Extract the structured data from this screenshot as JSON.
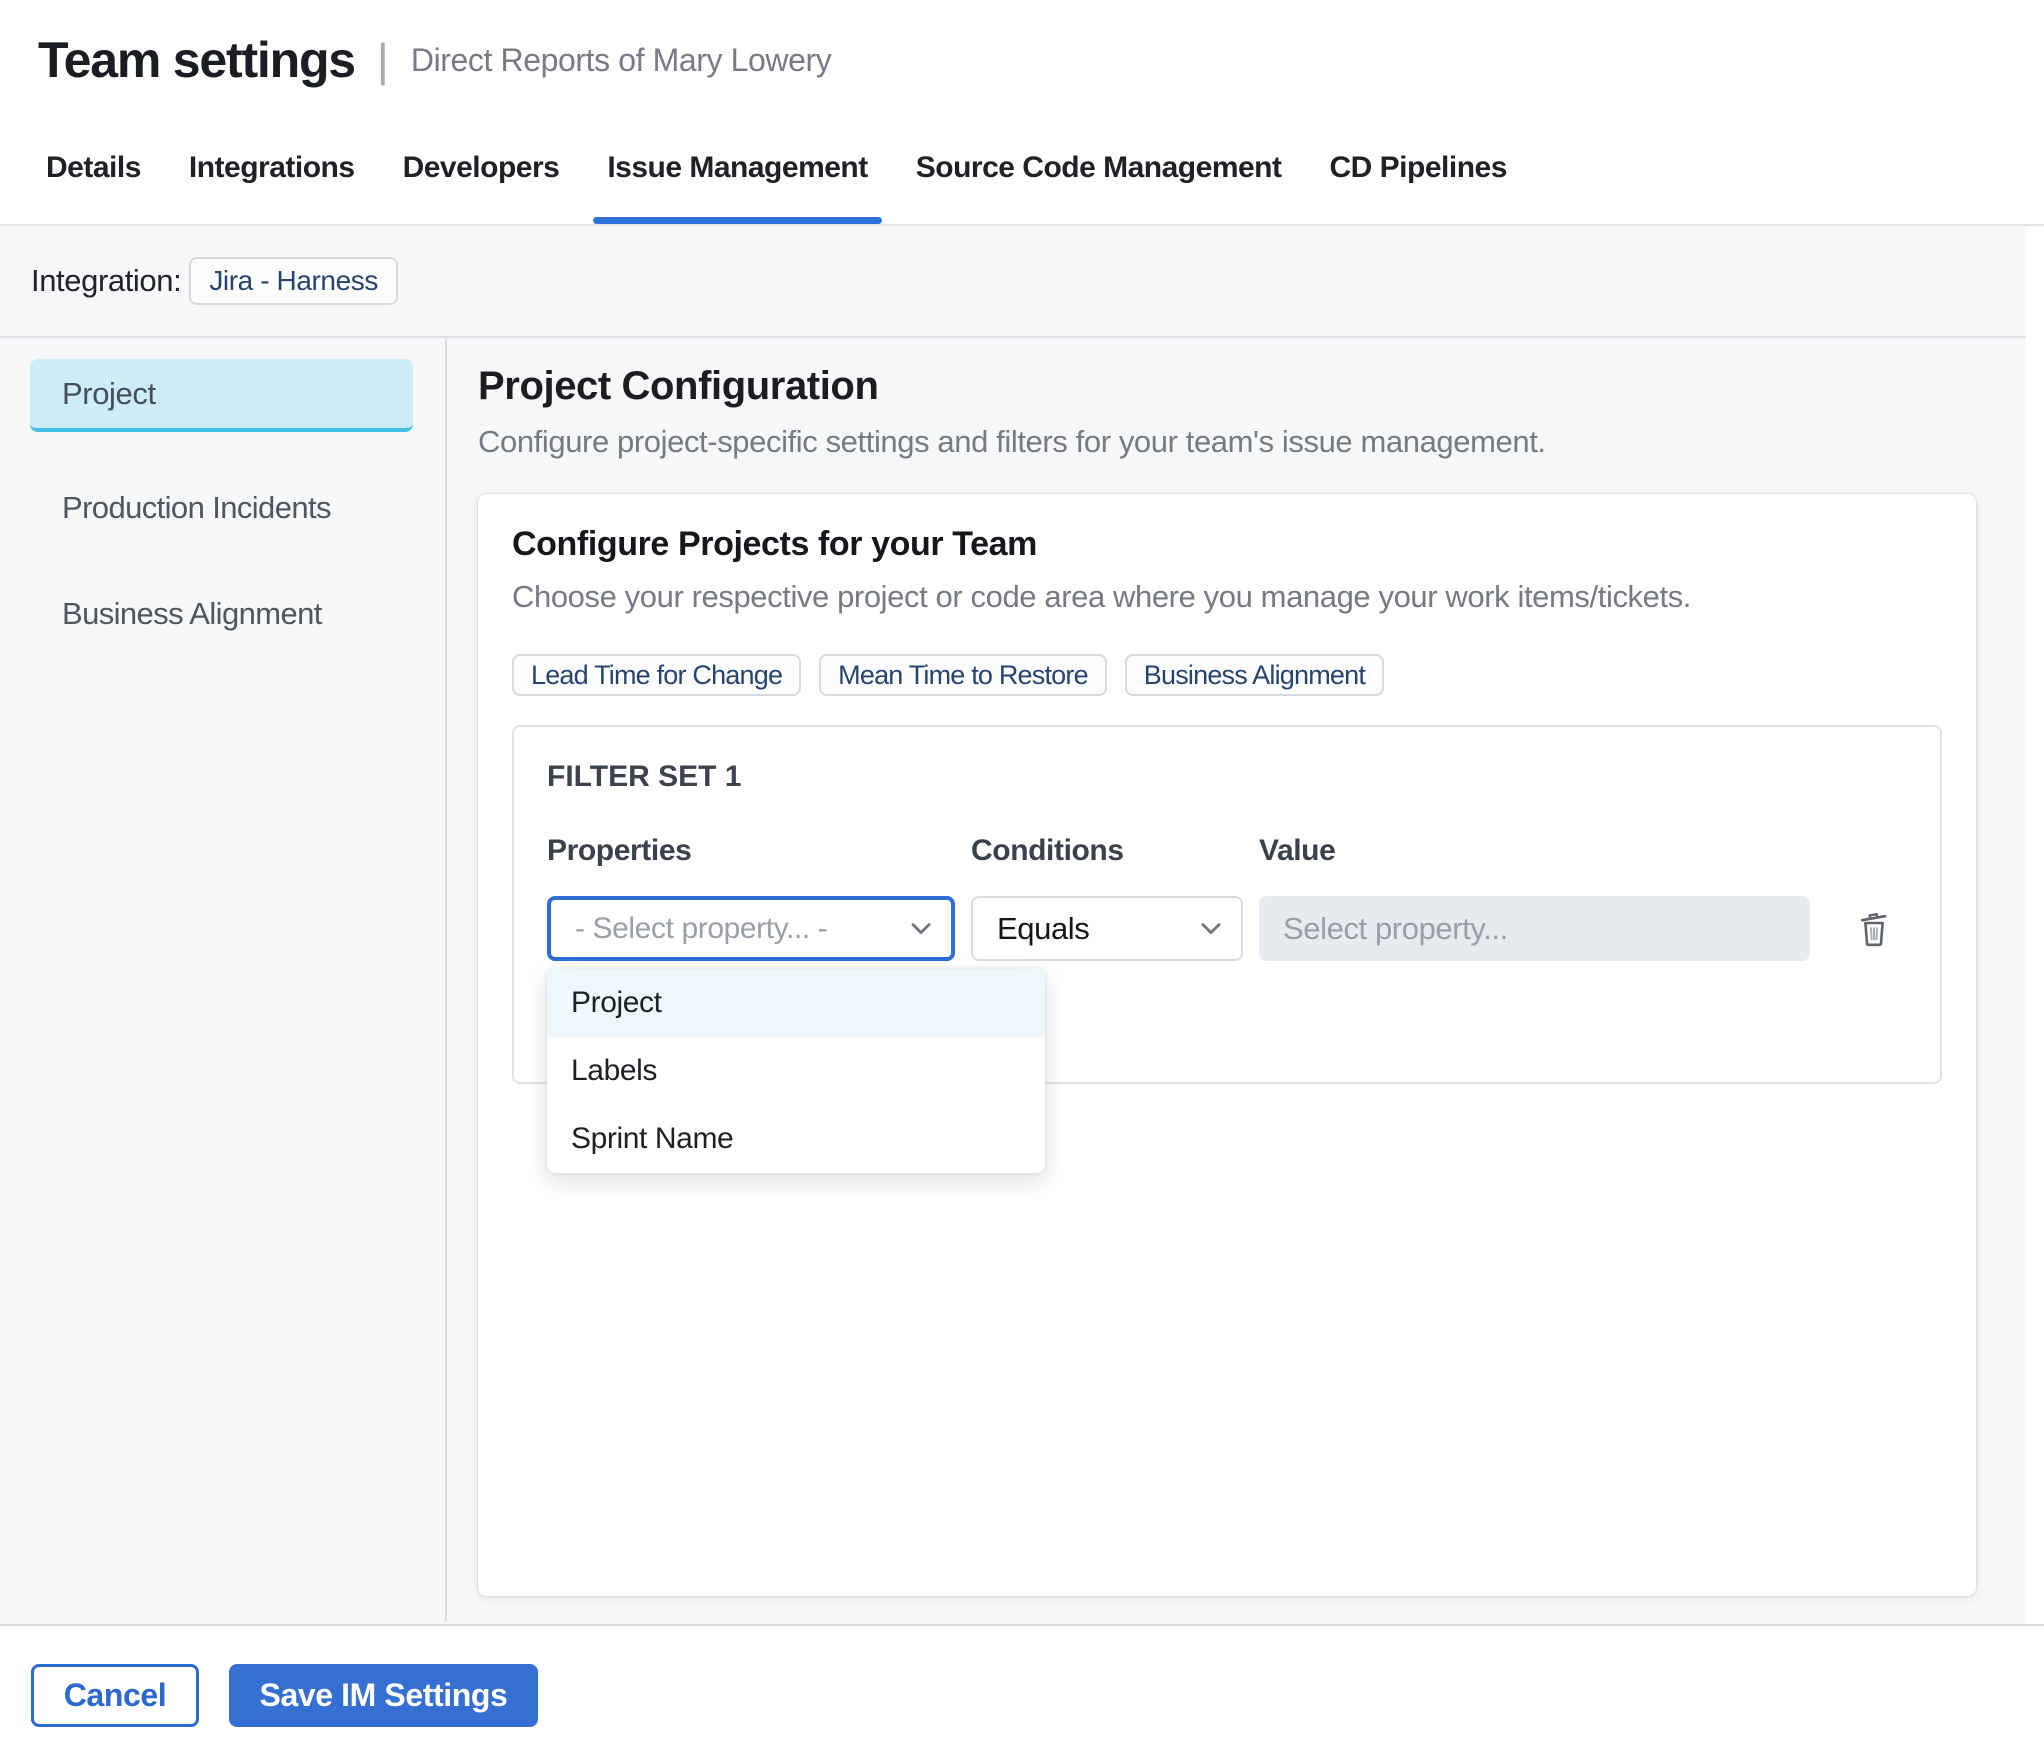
{
  "header": {
    "title": "Team settings",
    "separator": "|",
    "subtitle": "Direct Reports of Mary Lowery"
  },
  "tabs": {
    "items": [
      {
        "label": "Details"
      },
      {
        "label": "Integrations"
      },
      {
        "label": "Developers"
      },
      {
        "label": "Issue Management"
      },
      {
        "label": "Source Code Management"
      },
      {
        "label": "CD Pipelines"
      }
    ],
    "active_label": "Issue Management"
  },
  "integration": {
    "label": "Integration:",
    "chip": "Jira - Harness"
  },
  "sidebar": {
    "items": [
      {
        "label": "Project",
        "selected": true
      },
      {
        "label": "Production Incidents",
        "selected": false
      },
      {
        "label": "Business Alignment",
        "selected": false
      }
    ]
  },
  "main": {
    "heading": "Project Configuration",
    "subheading": "Configure project-specific settings and filters for your team's issue management.",
    "card": {
      "title": "Configure Projects for your Team",
      "description": "Choose your respective project or code area where you manage your work items/tickets.",
      "chips": [
        {
          "label": "Lead Time for Change"
        },
        {
          "label": "Mean Time to Restore"
        },
        {
          "label": "Business Alignment"
        }
      ],
      "filter_set": {
        "title": "FILTER SET 1",
        "columns": [
          {
            "label": "Properties"
          },
          {
            "label": "Conditions"
          },
          {
            "label": "Value"
          }
        ],
        "properties_select": {
          "placeholder": "- Select property... -"
        },
        "conditions_select": {
          "value": "Equals"
        },
        "value_input": {
          "placeholder": "Select property..."
        },
        "dropdown": {
          "options": [
            {
              "label": "Project",
              "highlighted": true
            },
            {
              "label": "Labels",
              "highlighted": false
            },
            {
              "label": "Sprint Name",
              "highlighted": false
            }
          ]
        }
      }
    }
  },
  "footer": {
    "cancel_label": "Cancel",
    "save_label": "Save IM Settings"
  },
  "colors": {
    "accent_blue": "#2e6fd6",
    "tab_underline": "#2e72d9",
    "selected_sidebar_bg": "#cdeef9",
    "selected_sidebar_border": "#44bfe4",
    "band_bg": "#f7f8fa",
    "chip_text": "#26446e",
    "dropdown_highlight": "#eef8fc",
    "save_button_bg": "#356fd2"
  }
}
